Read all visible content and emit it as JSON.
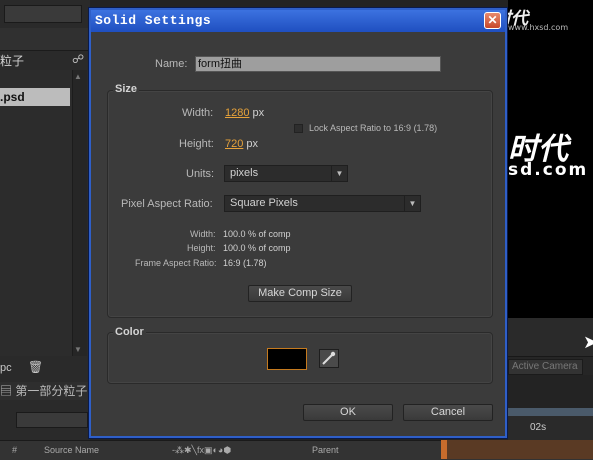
{
  "background": {
    "project_item_1": "粒子",
    "project_item_2": ".psd",
    "bpc": "pc",
    "timeline_tab": "第一部分粒子",
    "timeline_columns": [
      "#",
      "Source Name",
      "Parent"
    ],
    "active_camera": "Active Camera",
    "time_marker": "02s",
    "watermark_logo": "火星时代",
    "watermark_url": "www.hxsd.com",
    "viewer_text_1": "时代",
    "viewer_text_2": "sd.com"
  },
  "dialog": {
    "title": "Solid Settings",
    "close_label": "✕",
    "name_label": "Name:",
    "name_value": "form扭曲",
    "size": {
      "group_label": "Size",
      "width_label": "Width:",
      "width_value": "1280",
      "width_unit": "px",
      "height_label": "Height:",
      "height_value": "720",
      "height_unit": "px",
      "lock_aspect_label": "Lock Aspect Ratio to 16:9 (1.78)",
      "lock_aspect_checked": false,
      "units_label": "Units:",
      "units_value": "pixels",
      "par_label": "Pixel Aspect Ratio:",
      "par_value": "Square Pixels",
      "info_width_label": "Width:",
      "info_width_value": "100.0 % of comp",
      "info_height_label": "Height:",
      "info_height_value": "100.0 % of comp",
      "info_far_label": "Frame Aspect Ratio:",
      "info_far_value": "16:9 (1.78)",
      "make_comp_size_label": "Make Comp Size"
    },
    "color": {
      "group_label": "Color",
      "swatch_color": "#000000"
    },
    "ok_label": "OK",
    "cancel_label": "Cancel"
  }
}
